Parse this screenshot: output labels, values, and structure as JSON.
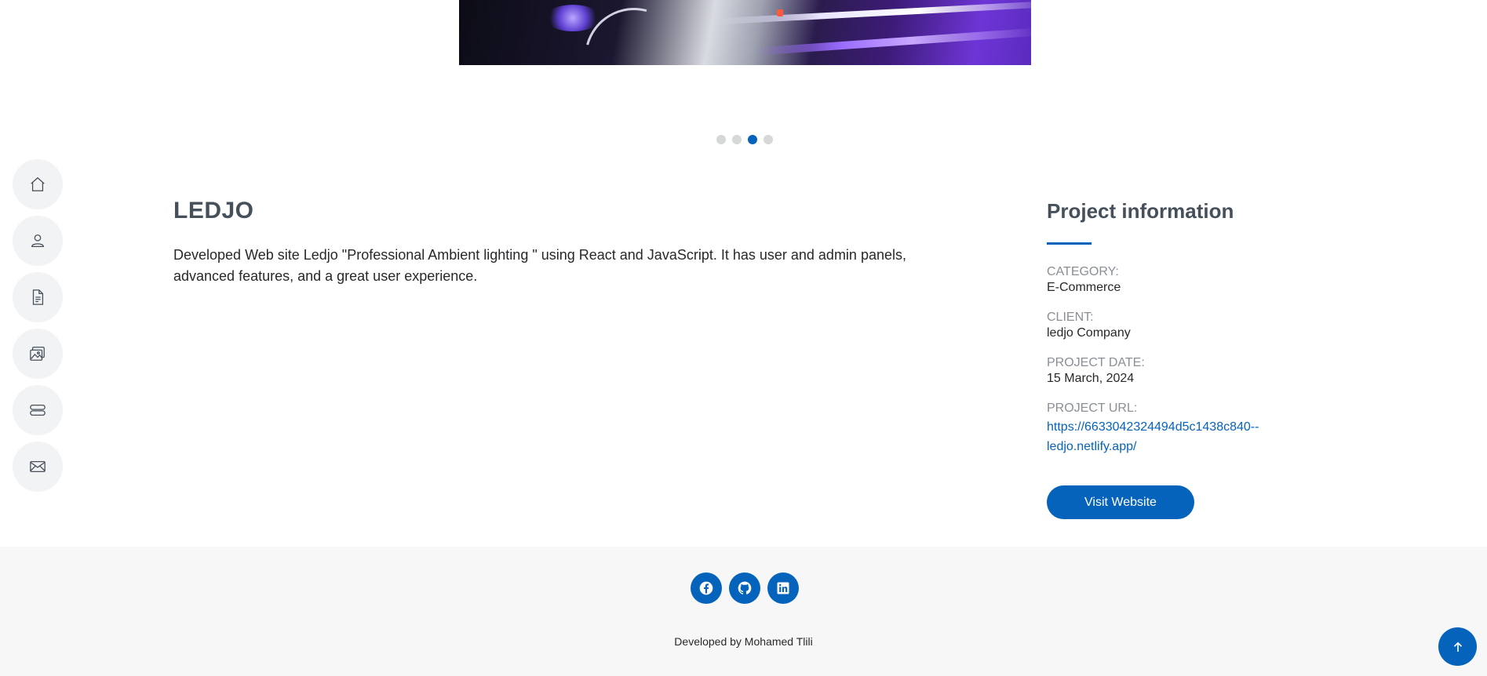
{
  "slider": {
    "dots": 4,
    "active_index": 2
  },
  "nav": {
    "items": [
      {
        "icon": "home-icon"
      },
      {
        "icon": "person-icon"
      },
      {
        "icon": "file-text-icon"
      },
      {
        "icon": "images-icon"
      },
      {
        "icon": "server-icon"
      },
      {
        "icon": "envelope-icon"
      }
    ]
  },
  "project": {
    "title": "LEDJO",
    "description": "Developed Web site Ledjo \"Professional Ambient lighting \" using React and JavaScript. It has user and admin panels, advanced features, and a great user experience."
  },
  "info": {
    "heading": "Project information",
    "category_label": "CATEGORY:",
    "category_value": "E-Commerce",
    "client_label": "CLIENT:",
    "client_value": "ledjo Company",
    "date_label": "PROJECT DATE:",
    "date_value": "15 March, 2024",
    "url_label": "PROJECT URL:",
    "url_line1": "https://6633042324494d5c1438c840--",
    "url_line2": "ledjo.netlify.app/",
    "visit_button": "Visit Website"
  },
  "footer": {
    "socials": [
      "facebook-icon",
      "github-icon",
      "linkedin-icon"
    ],
    "credit": "Developed by Mohamed Tlili"
  },
  "colors": {
    "accent": "#0563bb",
    "heading": "#45505b",
    "footer_bg": "#f7f7f7"
  }
}
